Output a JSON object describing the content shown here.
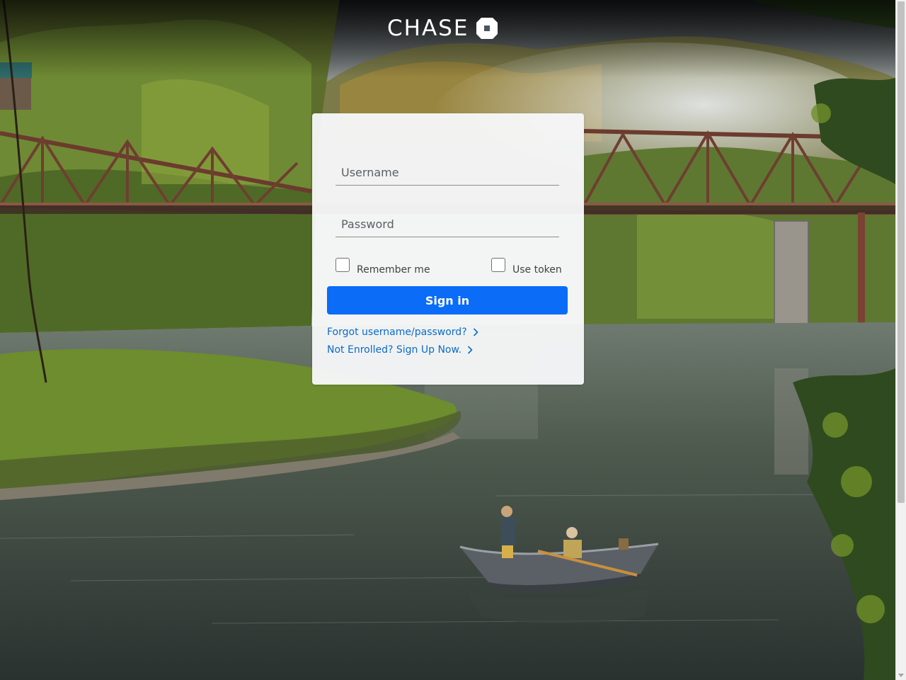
{
  "brand": {
    "name": "CHASE",
    "logo_icon": "chase-octagon-icon"
  },
  "login": {
    "username_placeholder": "Username",
    "password_placeholder": "Password",
    "remember_label": "Remember me",
    "token_label": "Use token",
    "signin_label": "Sign in",
    "forgot_link": "Forgot username/password?",
    "enroll_link": "Not Enrolled? Sign Up Now."
  },
  "colors": {
    "primary_button": "#0a6cf7",
    "link": "#0b6bc9",
    "card_background": "#f6f7f8"
  },
  "icons": {
    "chevron": "chevron-right-icon"
  }
}
